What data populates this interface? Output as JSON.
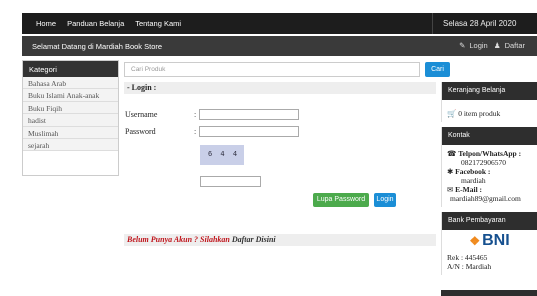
{
  "nav": {
    "items": [
      "Home",
      "Panduan Belanja",
      "Tentang Kami"
    ],
    "date": "Selasa 28 April 2020"
  },
  "welcome": {
    "text": "Selamat Datang di Mardiah Book Store",
    "login": "Login",
    "register": "Daftar"
  },
  "sidebar": {
    "title": "Kategori",
    "items": [
      "Bahasa Arab",
      "Buku Islami Anak-anak",
      "Buku Fiqih",
      "hadist",
      "Muslimah",
      "sejarah"
    ]
  },
  "search": {
    "placeholder": "Cari Produk",
    "button": "Cari"
  },
  "login_form": {
    "title": "- Login :",
    "username_label": "Username",
    "password_label": "Password",
    "colon": ":",
    "captcha_text": "6 4  4",
    "forgot_button": "Lupa Password",
    "login_button": "Login"
  },
  "register_note": {
    "prefix": "Belum Punya Akun ? Silahkan",
    "link": "Daftar Disini"
  },
  "cart": {
    "title": "Keranjang Belanja",
    "text": "0 item produk"
  },
  "contact": {
    "title": "Kontak",
    "phone_label": "Telpon/WhatsApp :",
    "phone": "082172906570",
    "facebook_label": "Facebook :",
    "facebook": "mardiah",
    "email_label": "E-Mail :",
    "email": "mardiah89@gmail.com"
  },
  "bank": {
    "title": "Bank Pembayaran",
    "logo": "BNI",
    "rek": "Rek : 445465",
    "an": "A/N : Mardiah"
  },
  "icons": [
    "user-icon",
    "people-icon",
    "cart-icon",
    "phone-icon",
    "chat-icon",
    "envelope-icon"
  ],
  "colors": {
    "primary_button": "#1b8ed6",
    "success_button": "#4caa4c",
    "dark_bar": "#1d1d1d",
    "note_red": "#c0141b"
  }
}
